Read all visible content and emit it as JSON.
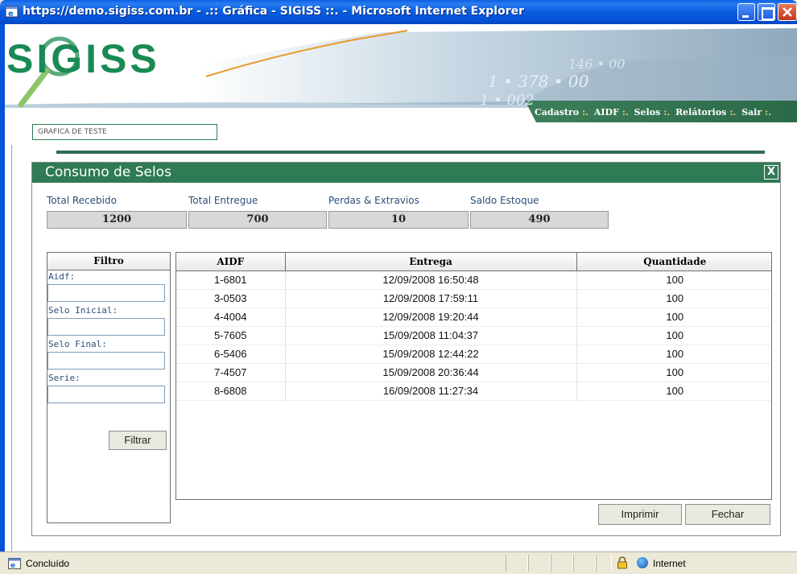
{
  "window": {
    "title": "https://demo.sigiss.com.br - .:: Gráfica - SIGISS ::. - Microsoft Internet Explorer"
  },
  "header": {
    "logo_text": "SIGISS",
    "username": "GRAFICA DE TESTE",
    "nav": [
      "Cadastro",
      "AIDF",
      "Selos",
      "Relátorios",
      "Sair"
    ],
    "nav_separator": ":."
  },
  "dialog": {
    "title": "Consumo de Selos",
    "close_label": "X",
    "summary": [
      {
        "label": "Total Recebido",
        "value": "1200"
      },
      {
        "label": "Total Entregue",
        "value": "700"
      },
      {
        "label": "Perdas & Extravios",
        "value": "10"
      },
      {
        "label": "Saldo Estoque",
        "value": "490"
      }
    ],
    "filter": {
      "header": "Filtro",
      "fields": [
        {
          "label": "Aidf:",
          "value": ""
        },
        {
          "label": "Selo Inicial:",
          "value": ""
        },
        {
          "label": "Selo Final:",
          "value": ""
        },
        {
          "label": "Serie:",
          "value": ""
        }
      ],
      "button": "Filtrar"
    },
    "table": {
      "columns": [
        "AIDF",
        "Entrega",
        "Quantidade"
      ],
      "rows": [
        [
          "1-6801",
          "12/09/2008 16:50:48",
          "100"
        ],
        [
          "3-0503",
          "12/09/2008 17:59:11",
          "100"
        ],
        [
          "4-4004",
          "12/09/2008 19:20:44",
          "100"
        ],
        [
          "5-7605",
          "15/09/2008 11:04:37",
          "100"
        ],
        [
          "6-5406",
          "15/09/2008 12:44:22",
          "100"
        ],
        [
          "7-4507",
          "15/09/2008 20:36:44",
          "100"
        ],
        [
          "8-6808",
          "16/09/2008 11:27:34",
          "100"
        ]
      ]
    },
    "buttons": {
      "print": "Imprimir",
      "close": "Fechar"
    }
  },
  "statusbar": {
    "status": "Concluído",
    "zone": "Internet"
  },
  "colors": {
    "brand_green": "#2e7b55",
    "titlebar_blue": "#0553d6"
  }
}
